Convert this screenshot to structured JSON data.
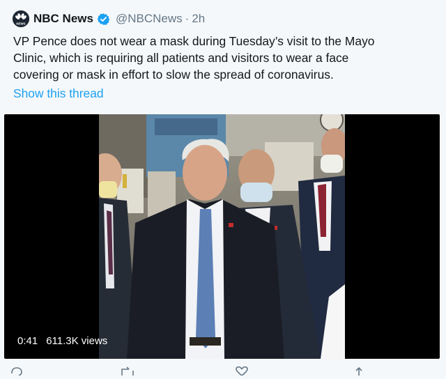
{
  "tweet": {
    "author_name": "NBC News",
    "handle": "@NBCNews",
    "separator": "·",
    "time": "2h",
    "text_lines": [
      "VP Pence does not wear a mask during Tuesday’s visit to the Mayo",
      "Clinic, which is requiring all patients and visitors to wear a face",
      "covering or mask in effort to slow the spread of coronavirus."
    ],
    "thread_link": "Show this thread",
    "logo_text": "NEWS"
  },
  "video": {
    "duration": "0:41",
    "views": "611.3K views"
  },
  "icons": {
    "logo": "nbc-peacock-icon",
    "verified": "verified-badge-icon",
    "reply": "reply-icon",
    "retweet": "retweet-icon",
    "like": "heart-icon",
    "share": "share-icon"
  },
  "colors": {
    "background": "#f5f8fa",
    "link": "#1da1f2",
    "verified": "#1da1f2",
    "text": "#14171a",
    "muted": "#657786"
  }
}
